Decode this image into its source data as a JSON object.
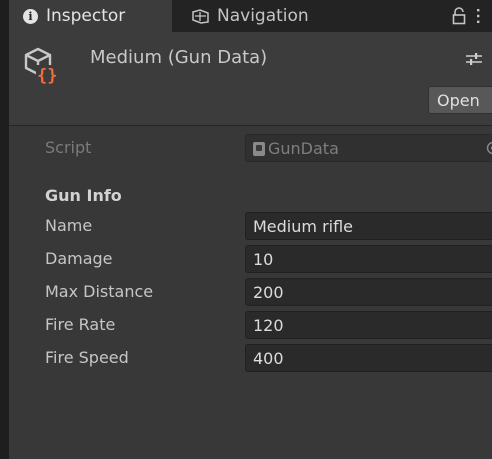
{
  "tabs": [
    {
      "label": "Inspector",
      "icon": "info-icon"
    },
    {
      "label": "Navigation",
      "icon": "navigation-icon"
    }
  ],
  "header": {
    "title": "Medium (Gun Data)",
    "open_label": "Open",
    "icon": "scriptable-object-icon"
  },
  "script": {
    "label": "Script",
    "value": "GunData"
  },
  "section": {
    "title": "Gun Info"
  },
  "fields": [
    {
      "label": "Name",
      "value": "Medium rifle"
    },
    {
      "label": "Damage",
      "value": "10"
    },
    {
      "label": "Max Distance",
      "value": "200"
    },
    {
      "label": "Fire Rate",
      "value": "120"
    },
    {
      "label": "Fire Speed",
      "value": "400"
    }
  ],
  "colors": {
    "accent_orange": "#f26b3a",
    "icon_light": "#c8c8c8"
  }
}
